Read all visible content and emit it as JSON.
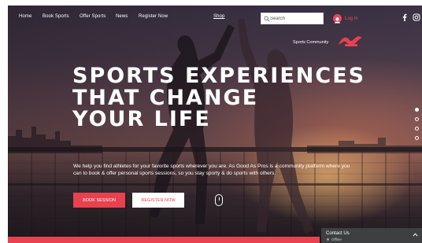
{
  "nav": {
    "items": [
      {
        "label": "Home"
      },
      {
        "label": "Book Sports"
      },
      {
        "label": "Offer Sports"
      },
      {
        "label": "News"
      },
      {
        "label": "Register Now"
      }
    ],
    "shop": "Shop",
    "search_placeholder": "Search",
    "login_label": "Log In",
    "community": "Sports Community"
  },
  "hero": {
    "title_lines": [
      "SPORTS EXPERIENCES",
      "THAT CHANGE",
      "YOUR LIFE"
    ],
    "description": "We help you find athletes for your favorite sports wherever you are. As Good As Pros is a community platform where you can to book & offer personal sports sessions, so you stay sporty & do sports with others.",
    "primary_button": "BOOK SESSION",
    "secondary_button": "REGISTER NOW"
  },
  "slides": {
    "count": 4,
    "active_index": 0
  },
  "contact": {
    "title": "Contact Us",
    "status": "Offline"
  },
  "colors": {
    "accent": "#e8414f",
    "text": "#ffffff",
    "chat_bg": "#3e3f40"
  },
  "icons": [
    "search-icon",
    "avatar-icon",
    "facebook-icon",
    "instagram-icon",
    "chevron-up-icon",
    "scroll-down-icon"
  ]
}
